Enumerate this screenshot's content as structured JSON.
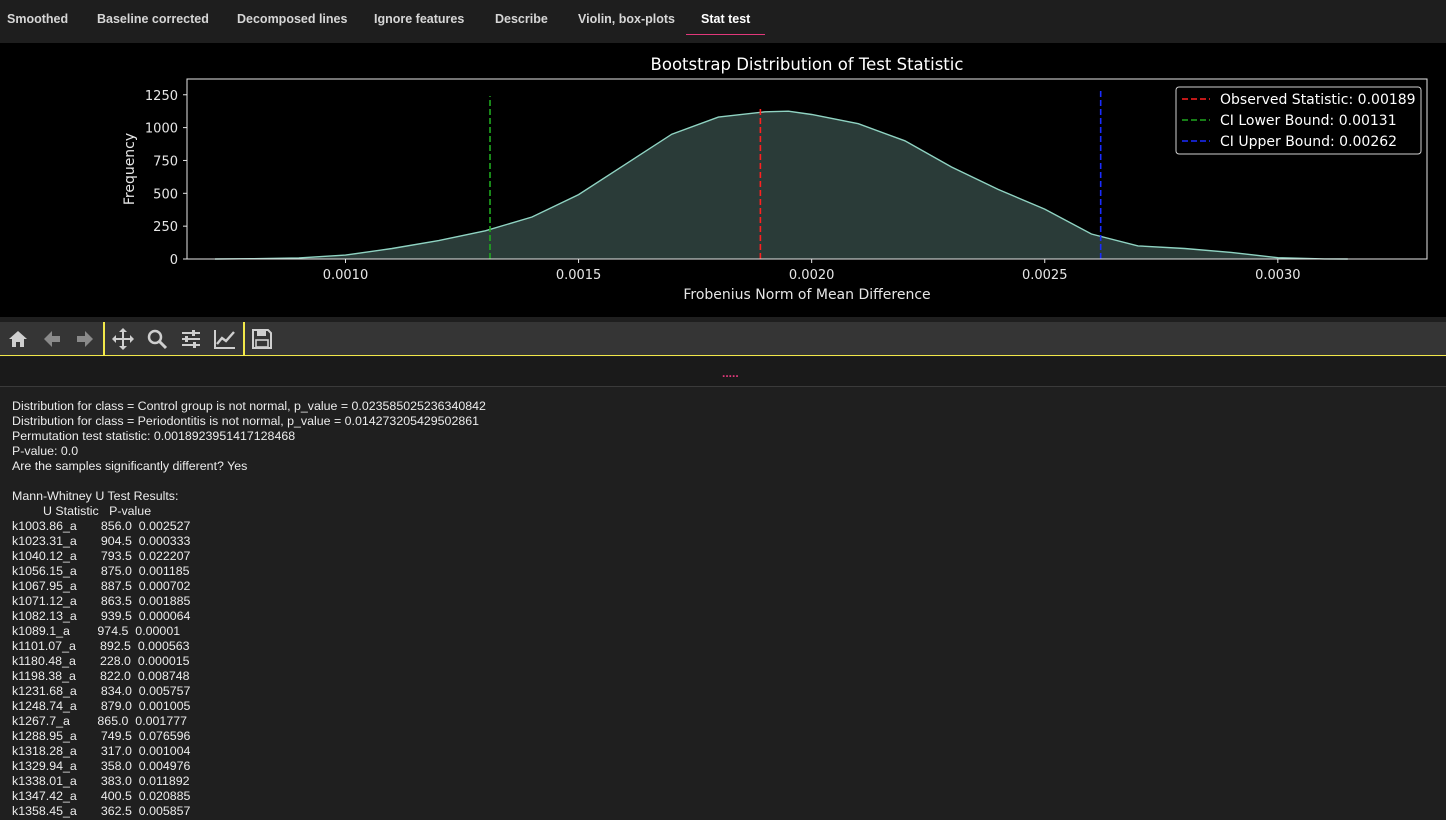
{
  "tabs": [
    {
      "label": "Smoothed",
      "active": false
    },
    {
      "label": "Baseline corrected",
      "active": false
    },
    {
      "label": "Decomposed lines",
      "active": false
    },
    {
      "label": "Ignore features",
      "active": false
    },
    {
      "label": "Describe",
      "active": false
    },
    {
      "label": "Violin, box-plots",
      "active": false
    },
    {
      "label": "Stat test",
      "active": true
    }
  ],
  "chart_data": {
    "type": "area",
    "title": "Bootstrap Distribution of Test Statistic",
    "xlabel": "Frobenius Norm of Mean Difference",
    "ylabel": "Frequency",
    "xlim": [
      0.00066,
      0.00332
    ],
    "ylim": [
      0,
      1370
    ],
    "x_ticks": [
      0.001,
      0.0015,
      0.002,
      0.0025,
      0.003
    ],
    "x_tick_labels": [
      "0.0010",
      "0.0015",
      "0.0020",
      "0.0025",
      "0.0030"
    ],
    "y_ticks": [
      0,
      250,
      500,
      750,
      1000,
      1250
    ],
    "y_tick_labels": [
      "0",
      "250",
      "500",
      "750",
      "1000",
      "1250"
    ],
    "grid": false,
    "legend_position": "top-right",
    "series": [
      {
        "color": "#8fd3c2",
        "fill": "#2a3b38",
        "x": [
          0.00072,
          0.0008,
          0.0009,
          0.001,
          0.0011,
          0.0012,
          0.0013,
          0.0014,
          0.0015,
          0.0016,
          0.0017,
          0.0018,
          0.0019,
          0.00195,
          0.002,
          0.0021,
          0.0022,
          0.0023,
          0.0024,
          0.0025,
          0.0026,
          0.0027,
          0.0028,
          0.0029,
          0.003,
          0.0031,
          0.00315
        ],
        "y": [
          0,
          2,
          8,
          30,
          80,
          140,
          215,
          320,
          490,
          720,
          950,
          1080,
          1120,
          1125,
          1100,
          1030,
          900,
          700,
          530,
          380,
          190,
          100,
          80,
          50,
          10,
          1,
          0
        ]
      }
    ],
    "vlines": [
      {
        "label": "Observed Statistic: 0.00189",
        "x": 0.00189,
        "color": "#ff2020",
        "ymax": 1160
      },
      {
        "label": "CI Lower Bound: 0.00131",
        "x": 0.00131,
        "color": "#1fa81f",
        "ymax": 1240
      },
      {
        "label": "CI Upper Bound: 0.00262",
        "x": 0.00262,
        "color": "#1a2cff",
        "ymax": 1300
      }
    ]
  },
  "toolbar": {
    "icons": [
      "home-icon",
      "back-arrow-icon",
      "forward-arrow-icon",
      "pan-icon",
      "zoom-icon",
      "configure-subplots-icon",
      "edit-axis-icon",
      "save-icon"
    ]
  },
  "splitter": {
    "handle": "....."
  },
  "output": {
    "lines": [
      "Distribution for class = Control group is not normal, p_value = 0.023585025236340842",
      "Distribution for class = Periodontitis is not normal, p_value = 0.014273205429502861",
      "Permutation test statistic: 0.0018923951417128468",
      "P-value: 0.0",
      "Are the samples significantly different? Yes",
      "",
      "Mann-Whitney U Test Results:",
      "         U Statistic   P-value",
      "k1003.86_a       856.0  0.002527",
      "k1023.31_a       904.5  0.000333",
      "k1040.12_a       793.5  0.022207",
      "k1056.15_a       875.0  0.001185",
      "k1067.95_a       887.5  0.000702",
      "k1071.12_a       863.5  0.001885",
      "k1082.13_a       939.5  0.000064",
      "k1089.1_a        974.5  0.00001",
      "k1101.07_a       892.5  0.000563",
      "k1180.48_a       228.0  0.000015",
      "k1198.38_a       822.0  0.008748",
      "k1231.68_a       834.0  0.005757",
      "k1248.74_a       879.0  0.001005",
      "k1267.7_a        865.0  0.001777",
      "k1288.95_a       749.5  0.076596",
      "k1318.28_a       317.0  0.001004",
      "k1329.94_a       358.0  0.004976",
      "k1338.01_a       383.0  0.011892",
      "k1347.42_a       400.5  0.020885",
      "k1358.45_a       362.5  0.005857"
    ]
  }
}
